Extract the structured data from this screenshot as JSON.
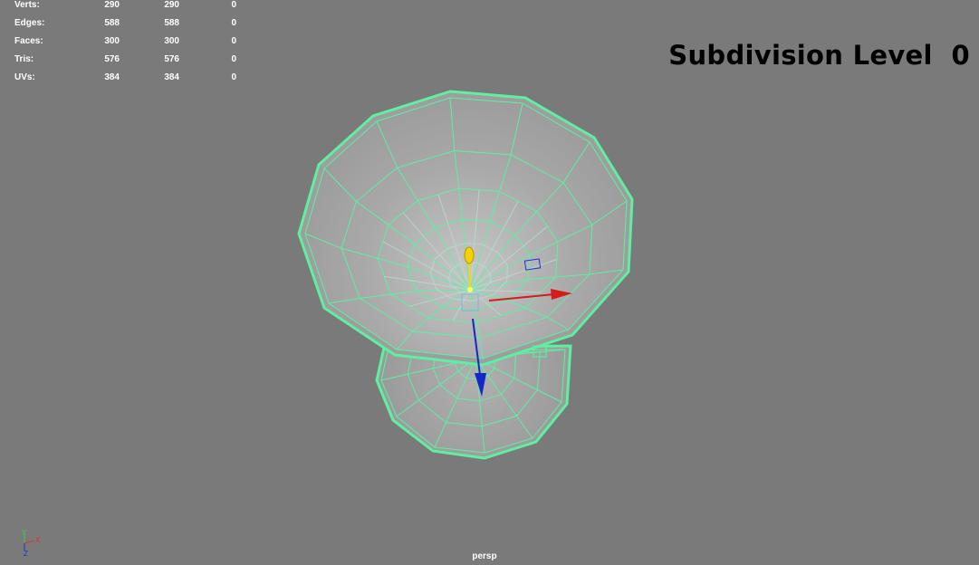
{
  "hud": {
    "rows": [
      {
        "label": "Verts:",
        "v1": "290",
        "v2": "290",
        "v3": "0"
      },
      {
        "label": "Edges:",
        "v1": "588",
        "v2": "588",
        "v3": "0"
      },
      {
        "label": "Faces:",
        "v1": "300",
        "v2": "300",
        "v3": "0"
      },
      {
        "label": "Tris:",
        "v1": "576",
        "v2": "576",
        "v3": "0"
      },
      {
        "label": "UVs:",
        "v1": "384",
        "v2": "384",
        "v3": "0"
      }
    ]
  },
  "title": "Subdivision Level  0",
  "camera": "persp",
  "axis": {
    "y": "Y",
    "x": "X",
    "z": "Z"
  },
  "colors": {
    "background": "#7a7a7a",
    "wireframe": "#5ef0a0",
    "surface": "#a3a3a3",
    "manip_x": "#d41c1c",
    "manip_y": "#ffd400",
    "manip_z": "#1428c8"
  }
}
